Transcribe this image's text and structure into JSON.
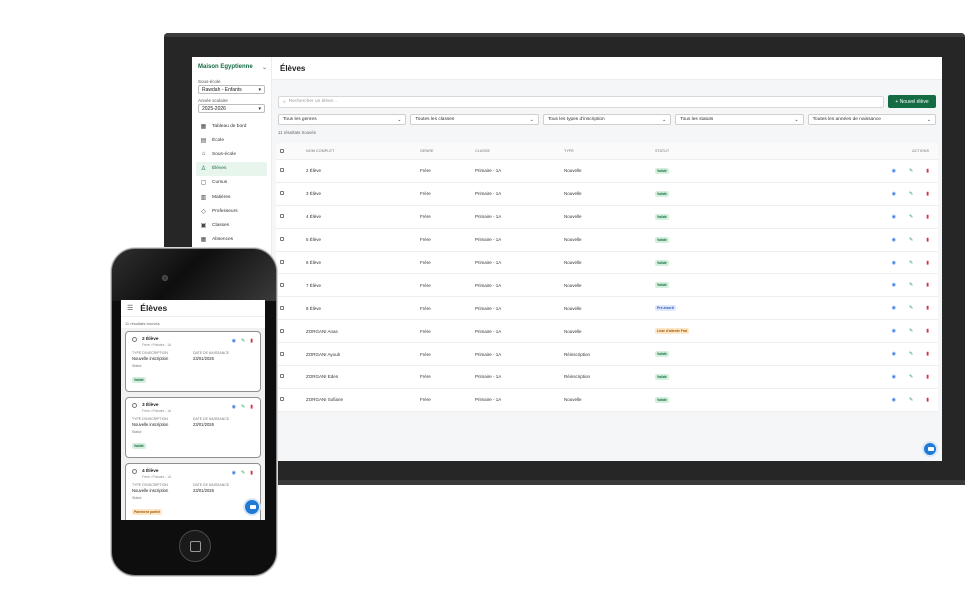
{
  "sidebar": {
    "brand": "Maison Egyptienne",
    "sub_school_label": "Sous-école",
    "sub_school_value": "Rawdah - Enfants",
    "year_label": "Année scolaire",
    "year_value": "2025-2026",
    "items": [
      {
        "label": "Tableau de bord",
        "icon": "grid-icon"
      },
      {
        "label": "École",
        "icon": "building-icon"
      },
      {
        "label": "Sous-école",
        "icon": "school-icon"
      },
      {
        "label": "Élèves",
        "icon": "users-icon"
      },
      {
        "label": "Cursus",
        "icon": "clipboard-icon"
      },
      {
        "label": "Matières",
        "icon": "book-icon"
      },
      {
        "label": "Professeurs",
        "icon": "graduation-icon"
      },
      {
        "label": "Classes",
        "icon": "classroom-icon"
      },
      {
        "label": "Absences",
        "icon": "calendar-icon"
      }
    ]
  },
  "page": {
    "title": "Élèves",
    "search_placeholder": "Rechercher un élève...",
    "new_button": "+ Nouvel élève",
    "filters": [
      "Tous les genres",
      "Toutes les classes",
      "Tous les types d'inscription",
      "Tous les statuts",
      "Toutes les années de naissance"
    ],
    "result_count": "11 résultats trouvés"
  },
  "table": {
    "headers": [
      "Nom complet",
      "Genre",
      "Classe",
      "Type",
      "Statut",
      "Actions"
    ],
    "rows": [
      {
        "name": "2 Élève",
        "gender": "Frère",
        "class": "Primaire - 1A",
        "type": "Nouvelle",
        "status": "Validé",
        "tone": "green"
      },
      {
        "name": "3 Élève",
        "gender": "Frère",
        "class": "Primaire - 1A",
        "type": "Nouvelle",
        "status": "Validé",
        "tone": "green"
      },
      {
        "name": "4 Élève",
        "gender": "Frère",
        "class": "Primaire - 1A",
        "type": "Nouvelle",
        "status": "Validé",
        "tone": "green"
      },
      {
        "name": "5 Élève",
        "gender": "Frère",
        "class": "Primaire - 1A",
        "type": "Nouvelle",
        "status": "Validé",
        "tone": "green"
      },
      {
        "name": "6 Élève",
        "gender": "Frère",
        "class": "Primaire - 1A",
        "type": "Nouvelle",
        "status": "Validé",
        "tone": "green"
      },
      {
        "name": "7 Élève",
        "gender": "Frère",
        "class": "Primaire - 1A",
        "type": "Nouvelle",
        "status": "Validé",
        "tone": "green"
      },
      {
        "name": "8 Élève",
        "gender": "Frère",
        "class": "Primaire - 1A",
        "type": "Nouvelle",
        "status": "Pré-inscrit",
        "tone": "blue"
      },
      {
        "name": "ZORGANI Anas",
        "gender": "Frère",
        "class": "Primaire - 1A",
        "type": "Nouvelle",
        "status": "Liste d'attente Frat",
        "tone": "orange"
      },
      {
        "name": "ZORGANI Ayoub",
        "gender": "Frère",
        "class": "Primaire - 1A",
        "type": "Réinscription",
        "status": "Validé",
        "tone": "green"
      },
      {
        "name": "ZORGANI Eden",
        "gender": "Frère",
        "class": "Primaire - 1A",
        "type": "Réinscription",
        "status": "Validé",
        "tone": "green"
      },
      {
        "name": "ZORGANI Sofiane",
        "gender": "Frère",
        "class": "Primaire - 1A",
        "type": "Nouvelle",
        "status": "Validé",
        "tone": "green"
      }
    ]
  },
  "mobile": {
    "title": "Élèves",
    "result_count": "11 résultats trouvés",
    "label_type": "Type d'inscription",
    "label_birth": "Date de naissance",
    "label_status": "Statut:",
    "cards": [
      {
        "name": "2 Élève",
        "sub": "Frère • Primaire - 1A",
        "type": "Nouvelle inscription",
        "birth": "23/01/2026",
        "status": "Validé",
        "tone": "green"
      },
      {
        "name": "3 Élève",
        "sub": "Frère • Primaire - 1A",
        "type": "Nouvelle inscription",
        "birth": "23/01/2026",
        "status": "Validé",
        "tone": "green"
      },
      {
        "name": "4 Élève",
        "sub": "Frère • Primaire - 1A",
        "type": "Nouvelle inscription",
        "birth": "23/01/2026",
        "status": "Paiement partiel",
        "tone": "orange"
      }
    ]
  },
  "colors": {
    "accent": "#146c43",
    "view": "#3d7ee0",
    "edit": "#22a453",
    "delete": "#d6313b",
    "chat": "#1f7ad6"
  }
}
